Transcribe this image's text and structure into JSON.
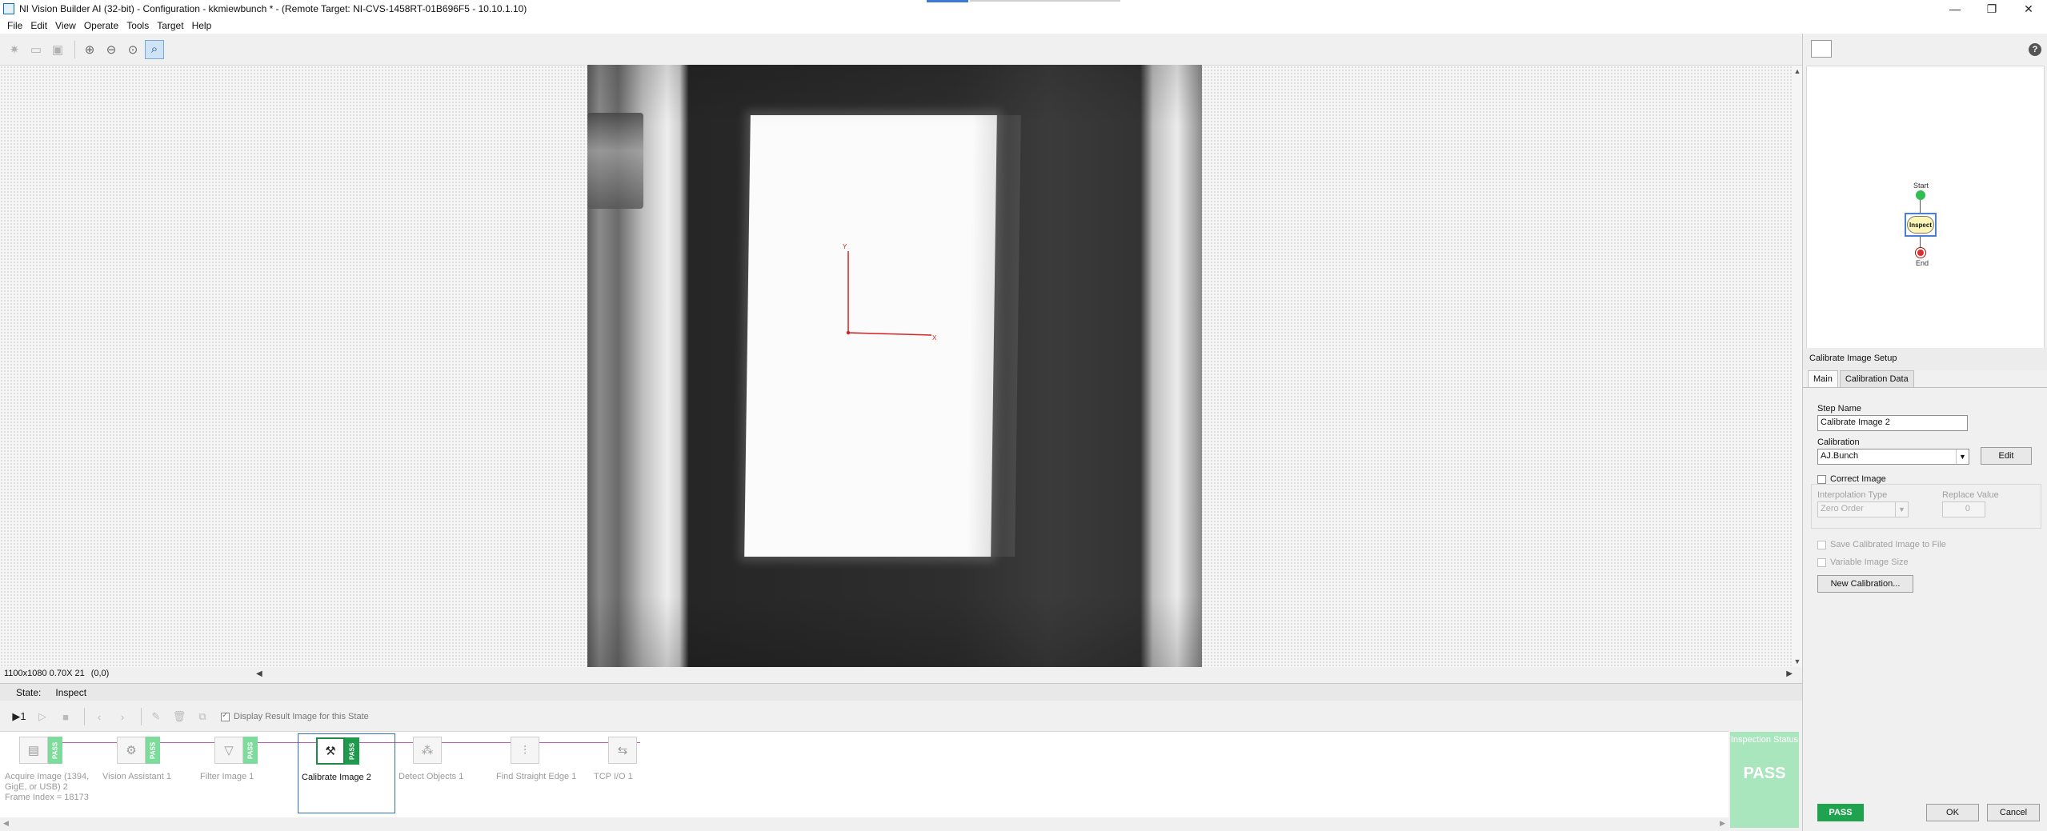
{
  "window": {
    "title": "NI Vision Builder AI (32-bit) - Configuration - kkmiewbunch * - (Remote Target: NI-CVS-1458RT-01B696F5 - 10.10.1.10)",
    "minimize": "—",
    "restore": "❐",
    "close": "✕"
  },
  "menu": [
    "File",
    "Edit",
    "View",
    "Operate",
    "Tools",
    "Target",
    "Help"
  ],
  "toolbar": {
    "icons": [
      "sun-icon",
      "folder-icon",
      "save-icon",
      "zoom-in-icon",
      "zoom-out-icon",
      "zoom-fit-icon",
      "zoom-select-icon"
    ]
  },
  "image_status": {
    "info": "1100x1080 0.70X 21",
    "coords": "(0,0)"
  },
  "calibration_axes": {
    "x_label": "X",
    "y_label": "Y",
    "color": "#d42020"
  },
  "state": {
    "label": "State:",
    "value": "Inspect"
  },
  "inspection_toolbar": {
    "display_result_label": "Display Result Image for this State",
    "display_result_checked": true
  },
  "steps": [
    {
      "caption": "Acquire Image (1394, GigE, or USB) 2\nFrame Index = 18173",
      "badge": "PASS",
      "icon": "camera-icon"
    },
    {
      "caption": "Vision Assistant 1",
      "badge": "PASS",
      "icon": "vision-assistant-icon"
    },
    {
      "caption": "Filter Image 1",
      "badge": "PASS",
      "icon": "filter-icon"
    },
    {
      "caption": "Calibrate Image 2",
      "badge": "PASS",
      "icon": "calibrate-icon",
      "selected": true
    },
    {
      "caption": "Detect Objects 1",
      "badge": "",
      "icon": "detect-objects-icon"
    },
    {
      "caption": "Find Straight Edge 1",
      "badge": "",
      "icon": "straight-edge-icon"
    },
    {
      "caption": "TCP I/O 1",
      "badge": "",
      "icon": "tcp-io-icon"
    }
  ],
  "inspection_status": {
    "title": "Inspection Status",
    "result": "PASS",
    "color": "#a9e5bd"
  },
  "flowchart": {
    "start": "Start",
    "inspect": "Inspect",
    "end": "End"
  },
  "setup": {
    "title": "Calibrate Image Setup",
    "tabs": [
      "Main",
      "Calibration Data"
    ],
    "step_name_label": "Step Name",
    "step_name_value": "Calibrate Image 2",
    "calibration_label": "Calibration",
    "calibration_value": "AJ.Bunch",
    "edit_button": "Edit",
    "correct_image_label": "Correct Image",
    "interpolation_label": "Interpolation Type",
    "interpolation_value": "Zero Order",
    "replace_label": "Replace Value",
    "replace_value": "0",
    "save_calibrated_label": "Save Calibrated Image to File",
    "variable_size_label": "Variable Image Size",
    "new_calibration_button": "New Calibration..."
  },
  "footer": {
    "pass": "PASS",
    "ok": "OK",
    "cancel": "Cancel"
  }
}
